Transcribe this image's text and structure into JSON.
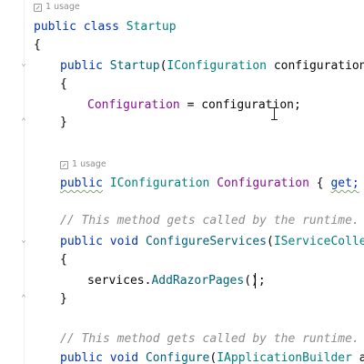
{
  "editor": {
    "usage_hint_1": "1 usage",
    "usage_hint_2": "1 usage",
    "lines": {
      "l1_public": "public",
      "l1_class": "class",
      "l1_name": "Startup",
      "l2_brace": "{",
      "l3_public": "public",
      "l3_ctor": "Startup",
      "l3_paren_open": "(",
      "l3_type": "IConfiguration",
      "l3_param": " configuration)",
      "l4_brace": "{",
      "l5_prop": "Configuration",
      "l5_assign": " = configuration;",
      "l6_brace": "}",
      "l7_public": "public",
      "l7_type": "IConfiguration",
      "l7_prop": "Configuration",
      "l7_open": " { ",
      "l7_get": "get;",
      "l7_close": " }",
      "l8_comment": "// This method gets called by the runtime. Use",
      "l9_public": "public",
      "l9_void": "void",
      "l9_fn": "ConfigureServices",
      "l9_paren": "(",
      "l9_type": "IServiceCollecti",
      "l10_brace": "{",
      "l11_obj": "services.",
      "l11_fn": "AddRazorPages",
      "l11_rest": "();",
      "l12_brace": "}",
      "l13_comment": "// This method gets called by the runtime. Use",
      "l14_public": "public",
      "l14_void": "void",
      "l14_fn": "Configure",
      "l14_paren": "(",
      "l14_type": "IApplicationBuilder",
      "l14_rest": " app,"
    }
  }
}
